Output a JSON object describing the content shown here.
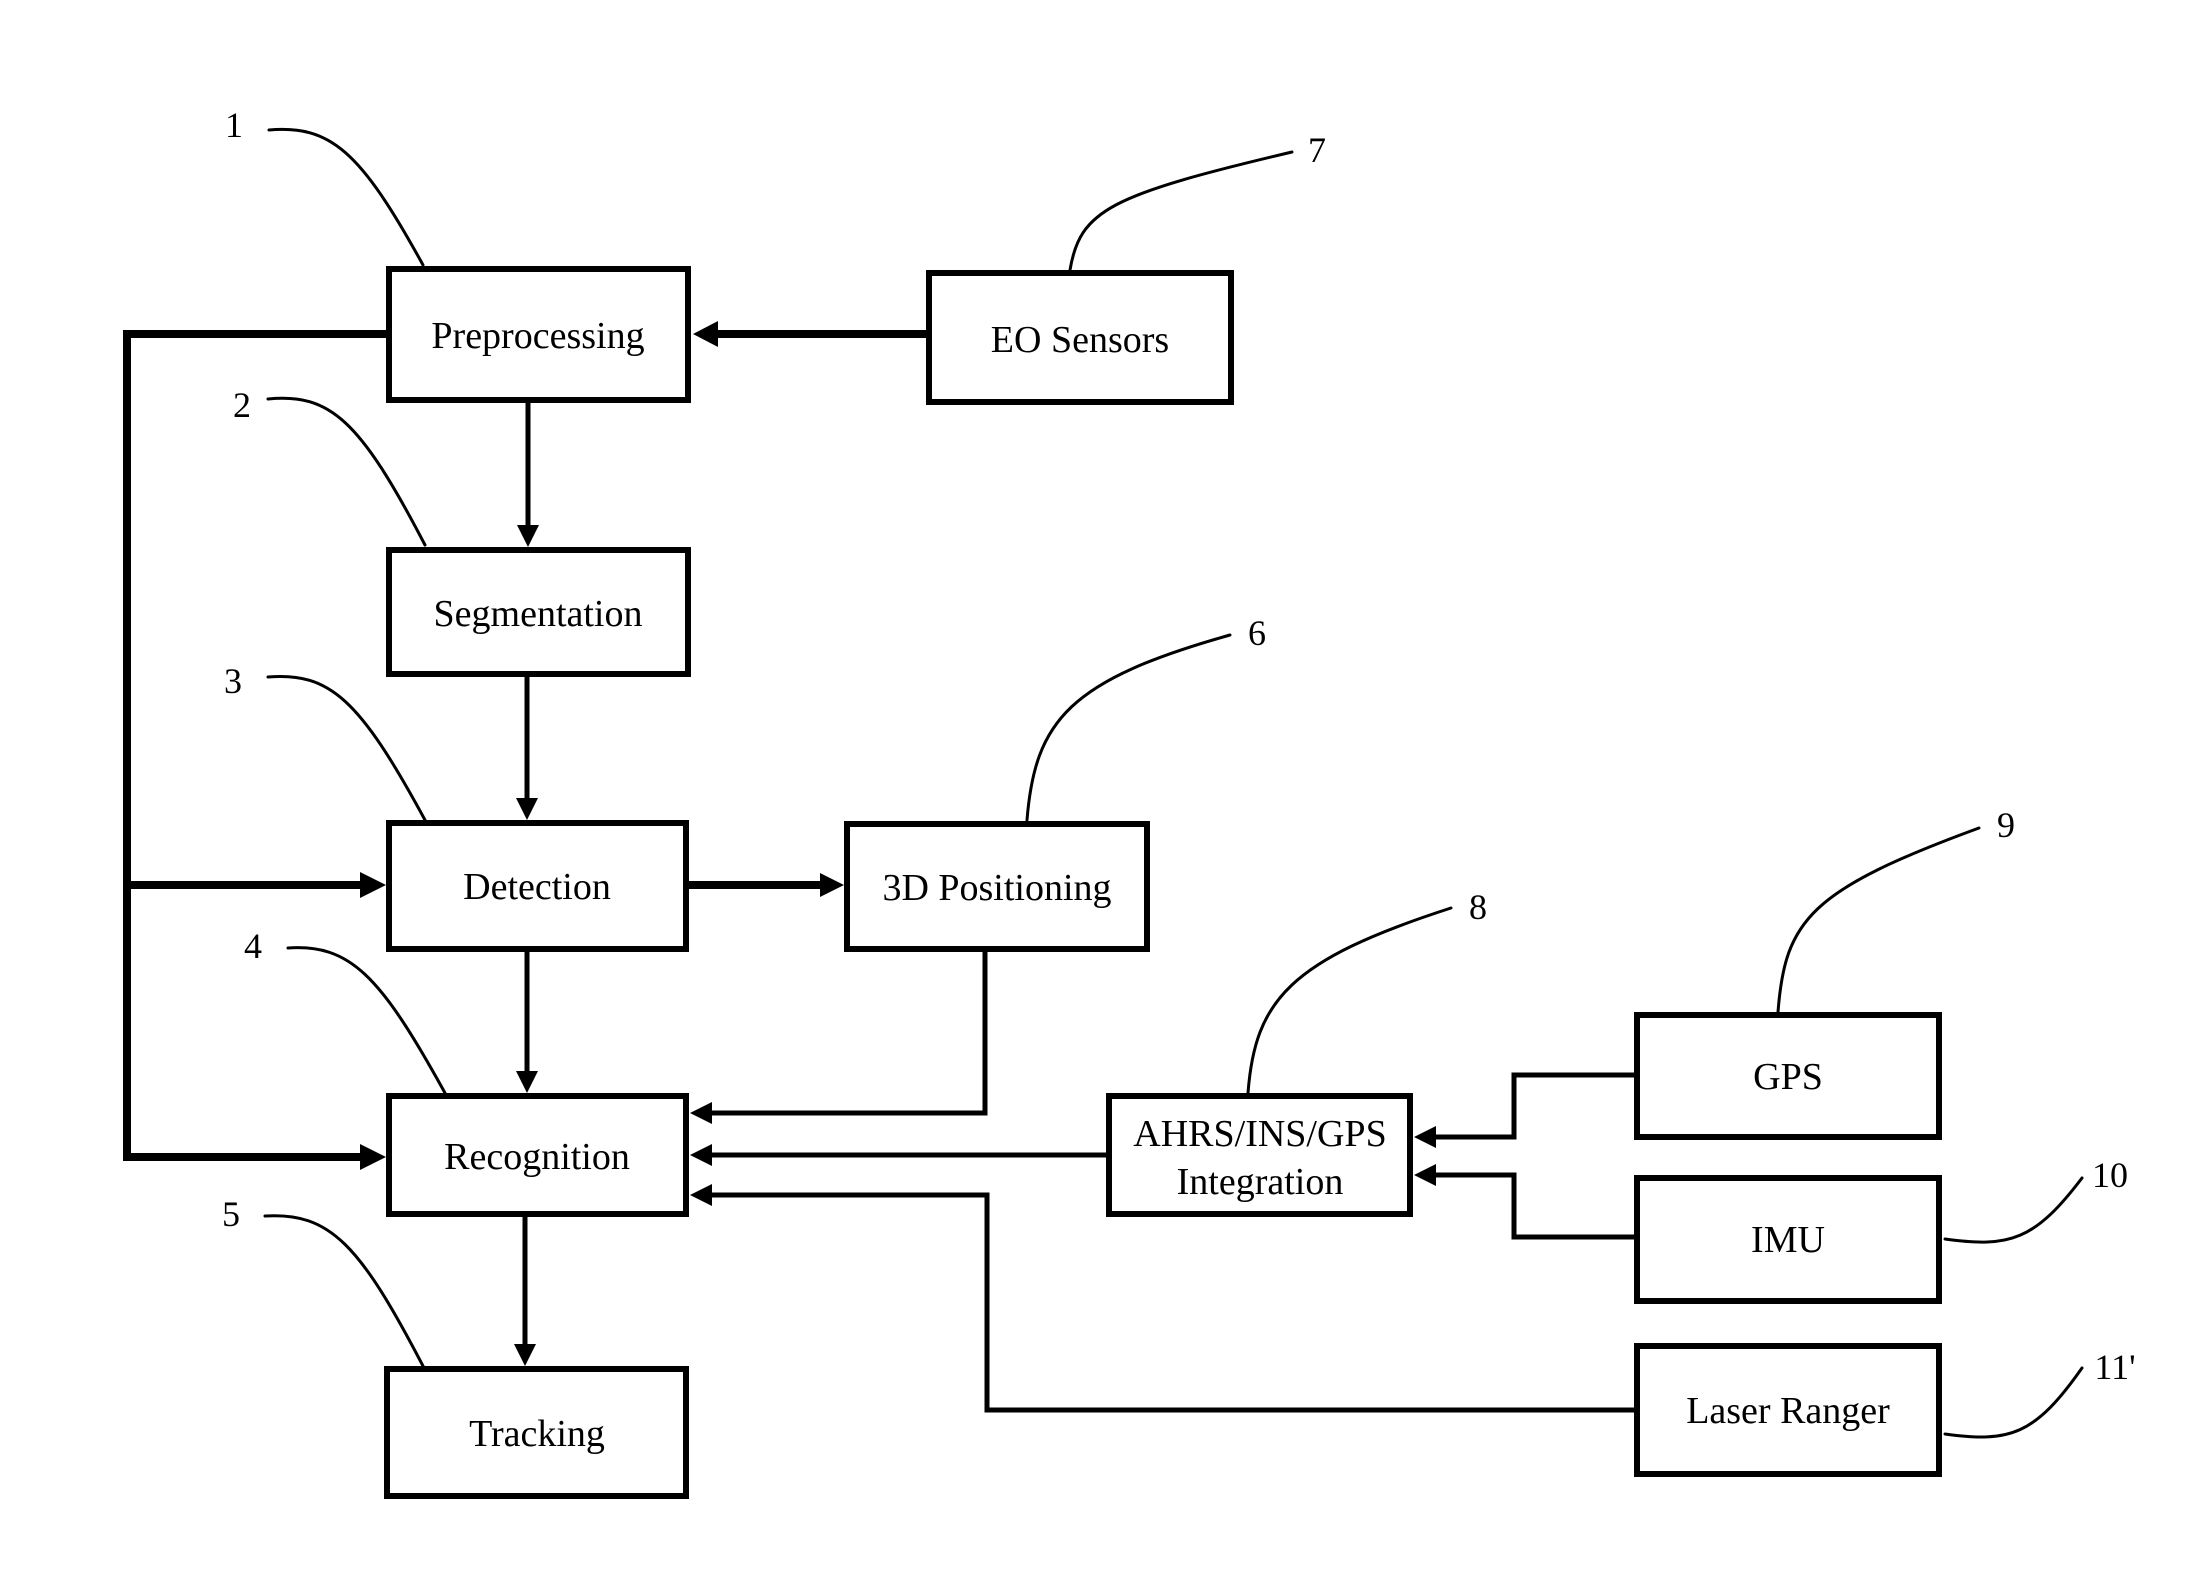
{
  "figure": {
    "type": "block-diagram",
    "colors": {
      "line": "#000000",
      "background": "#ffffff"
    }
  },
  "blocks": {
    "preprocessing": {
      "label": "Preprocessing",
      "ref": "1"
    },
    "segmentation": {
      "label": "Segmentation",
      "ref": "2"
    },
    "detection": {
      "label": "Detection",
      "ref": "3"
    },
    "recognition": {
      "label": "Recognition",
      "ref": "4"
    },
    "tracking": {
      "label": "Tracking",
      "ref": "5"
    },
    "positioning_3d": {
      "label": "3D Positioning",
      "ref": "6"
    },
    "eo_sensors": {
      "label": "EO Sensors",
      "ref": "7"
    },
    "ahrs_integration": {
      "label_line1": "AHRS/INS/GPS",
      "label_line2": "Integration",
      "ref": "8"
    },
    "gps": {
      "label": "GPS",
      "ref": "9"
    },
    "imu": {
      "label": "IMU",
      "ref": "10"
    },
    "laser_ranger": {
      "label": "Laser Ranger",
      "ref": "11'"
    }
  },
  "connections": [
    {
      "from": "EO Sensors",
      "to": "Preprocessing"
    },
    {
      "from": "Preprocessing",
      "to": "Segmentation"
    },
    {
      "from": "Segmentation",
      "to": "Detection"
    },
    {
      "from": "Preprocessing",
      "to": "Detection"
    },
    {
      "from": "Preprocessing",
      "to": "Recognition"
    },
    {
      "from": "Detection",
      "to": "3D Positioning"
    },
    {
      "from": "Detection",
      "to": "Recognition"
    },
    {
      "from": "3D Positioning",
      "to": "Recognition"
    },
    {
      "from": "AHRS/INS/GPS Integration",
      "to": "Recognition"
    },
    {
      "from": "Laser Ranger",
      "to": "Recognition"
    },
    {
      "from": "GPS",
      "to": "AHRS/INS/GPS Integration"
    },
    {
      "from": "IMU",
      "to": "AHRS/INS/GPS Integration"
    },
    {
      "from": "Recognition",
      "to": "Tracking"
    }
  ]
}
